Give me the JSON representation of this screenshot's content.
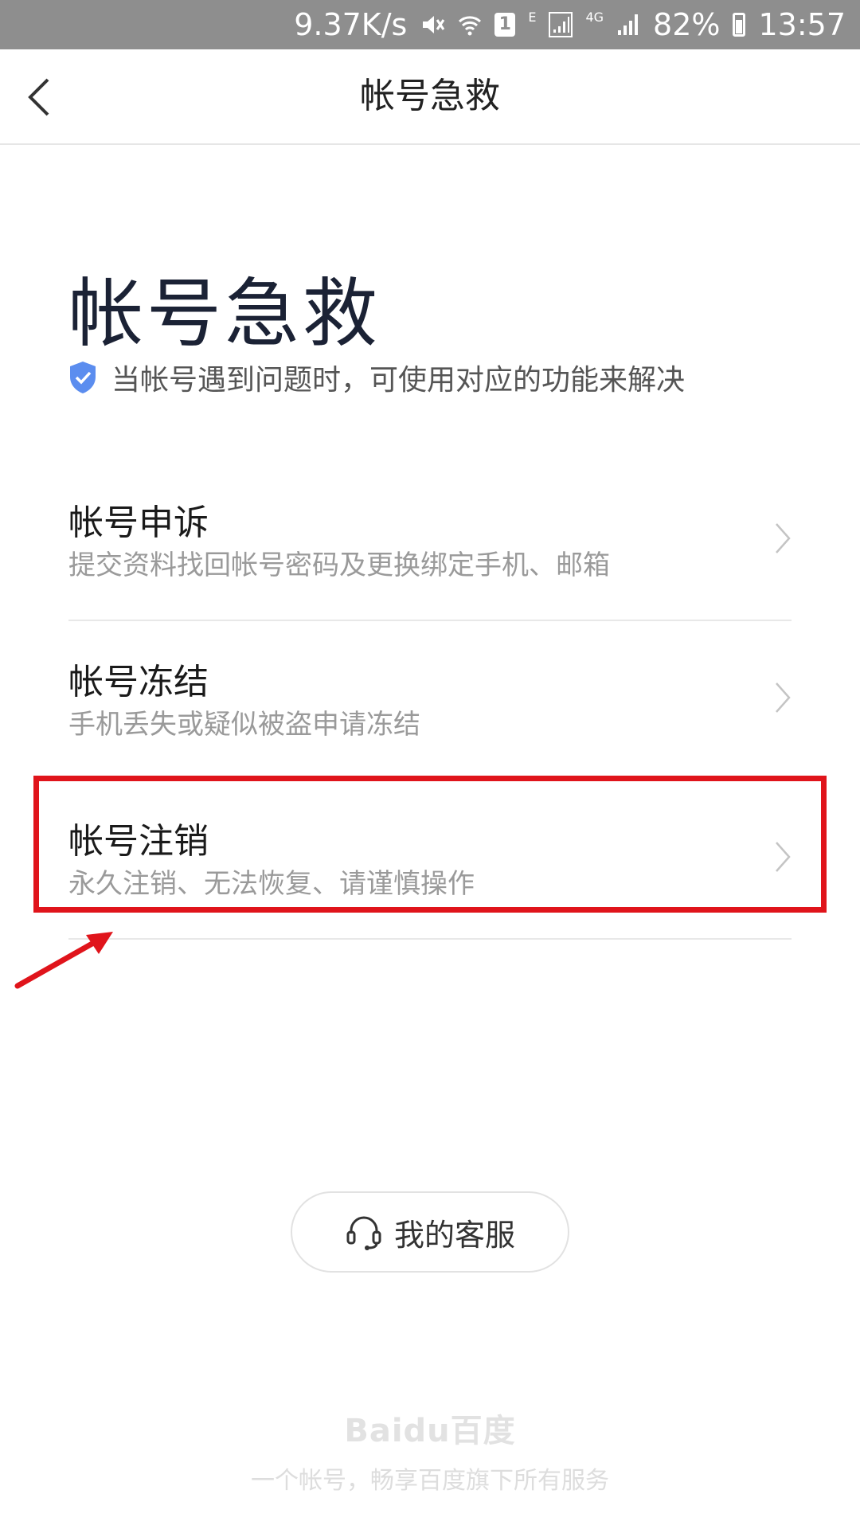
{
  "status_bar": {
    "net_speed": "9.37K/s",
    "sim_badge": "1",
    "network_e": "E",
    "network_4g": "4G",
    "battery": "82%",
    "time": "13:57"
  },
  "nav": {
    "title": "帐号急救"
  },
  "hero": {
    "title": "帐号急救",
    "subtitle": "当帐号遇到问题时，可使用对应的功能来解决"
  },
  "items": [
    {
      "title": "帐号申诉",
      "desc": "提交资料找回帐号密码及更换绑定手机、邮箱"
    },
    {
      "title": "帐号冻结",
      "desc": "手机丢失或疑似被盗申请冻结"
    },
    {
      "title": "帐号注销",
      "desc": "永久注销、无法恢复、请谨慎操作"
    }
  ],
  "service": {
    "label": "我的客服"
  },
  "footer": {
    "logo": "Baidu百度",
    "tagline": "一个帐号，畅享百度旗下所有服务"
  },
  "colors": {
    "highlight": "#e0141b",
    "shield": "#5b8def"
  }
}
